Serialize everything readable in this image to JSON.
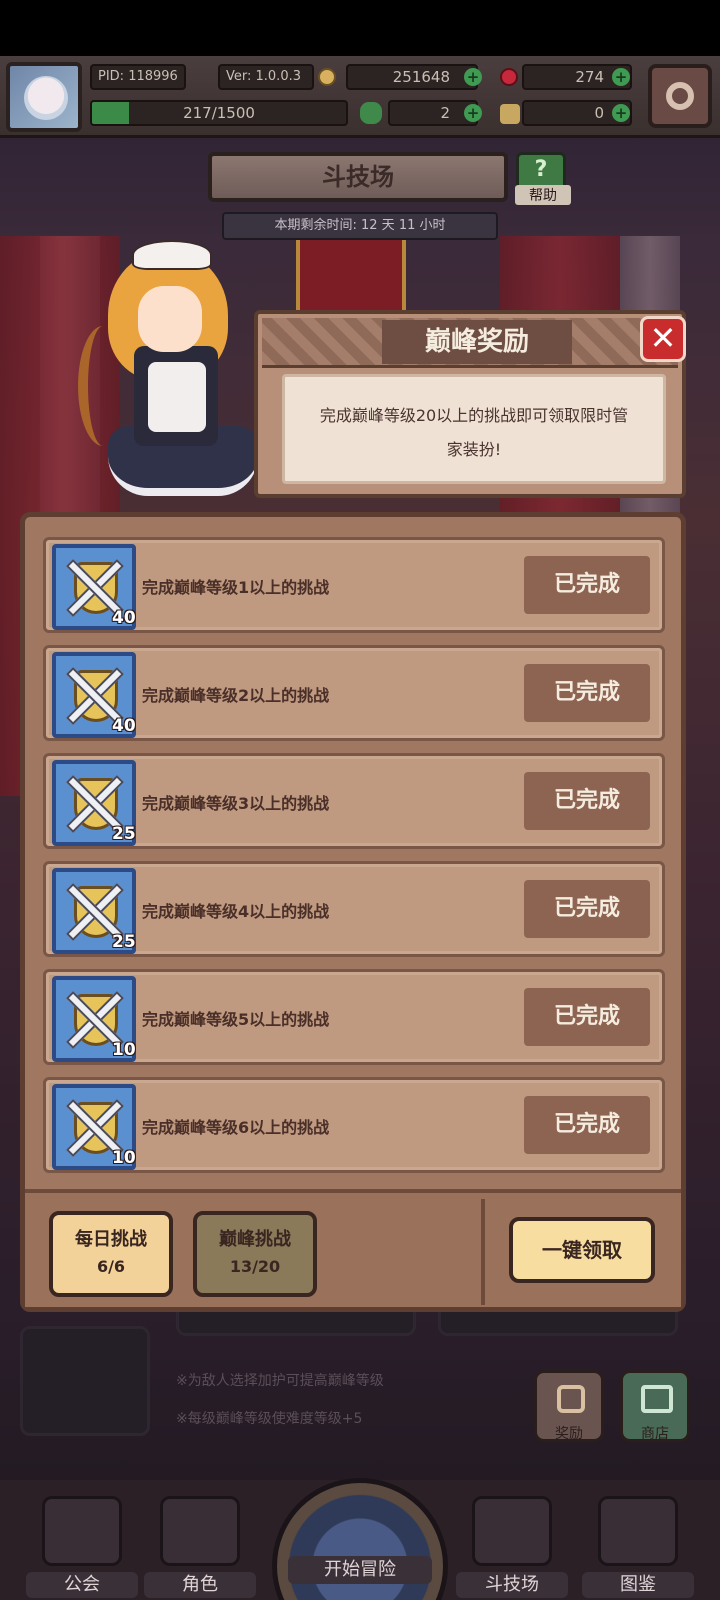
{
  "player": {
    "pid": "PID: 118996",
    "version": "Ver: 1.0.0.3",
    "gold": "251648",
    "gems": "274",
    "stamina": "217/1500",
    "stamina_fraction": 0.1447,
    "clovers": "2",
    "tickets": "0"
  },
  "header": {
    "title": "斗技场",
    "help_label": "帮助",
    "help_glyph": "?",
    "timer": "本期剩余时间: 12 天 11 小时"
  },
  "dialog": {
    "title": "巅峰奖励",
    "close_glyph": "✕",
    "body": "完成巅峰等级20以上的挑战即可领取限时管家装扮!"
  },
  "tasks": [
    {
      "text": "完成巅峰等级1以上的挑战",
      "count": "40",
      "status": "已完成"
    },
    {
      "text": "完成巅峰等级2以上的挑战",
      "count": "40",
      "status": "已完成"
    },
    {
      "text": "完成巅峰等级3以上的挑战",
      "count": "25",
      "status": "已完成"
    },
    {
      "text": "完成巅峰等级4以上的挑战",
      "count": "25",
      "status": "已完成"
    },
    {
      "text": "完成巅峰等级5以上的挑战",
      "count": "10",
      "status": "已完成"
    },
    {
      "text": "完成巅峰等级6以上的挑战",
      "count": "10",
      "status": "已完成"
    }
  ],
  "footer": {
    "daily_label": "每日挑战",
    "daily_value": "6/6",
    "summit_label": "巅峰挑战",
    "summit_value": "13/20",
    "claim_all": "一键领取"
  },
  "notes": [
    "※为敌人选择加护可提高巅峰等级",
    "※每级巅峰等级使难度等级+5"
  ],
  "side_buttons": {
    "reward": "奖励",
    "shop": "商店"
  },
  "nav": {
    "guild": "公会",
    "character": "角色",
    "adventure": "开始冒险",
    "arena": "斗技场",
    "codex": "图鉴"
  },
  "colors": {
    "panel": "#a07862",
    "task_row": "#bf9a80",
    "status_badge": "#8d6452",
    "close_button": "#c92c2c",
    "plus_button": "#3f9a52"
  },
  "icons": [
    "settings-gear-icon",
    "gold-coin-icon",
    "red-gem-icon",
    "clover-icon",
    "ticket-icon",
    "plus-icon",
    "help-icon",
    "close-icon",
    "crossed-swords-shield-icon"
  ]
}
